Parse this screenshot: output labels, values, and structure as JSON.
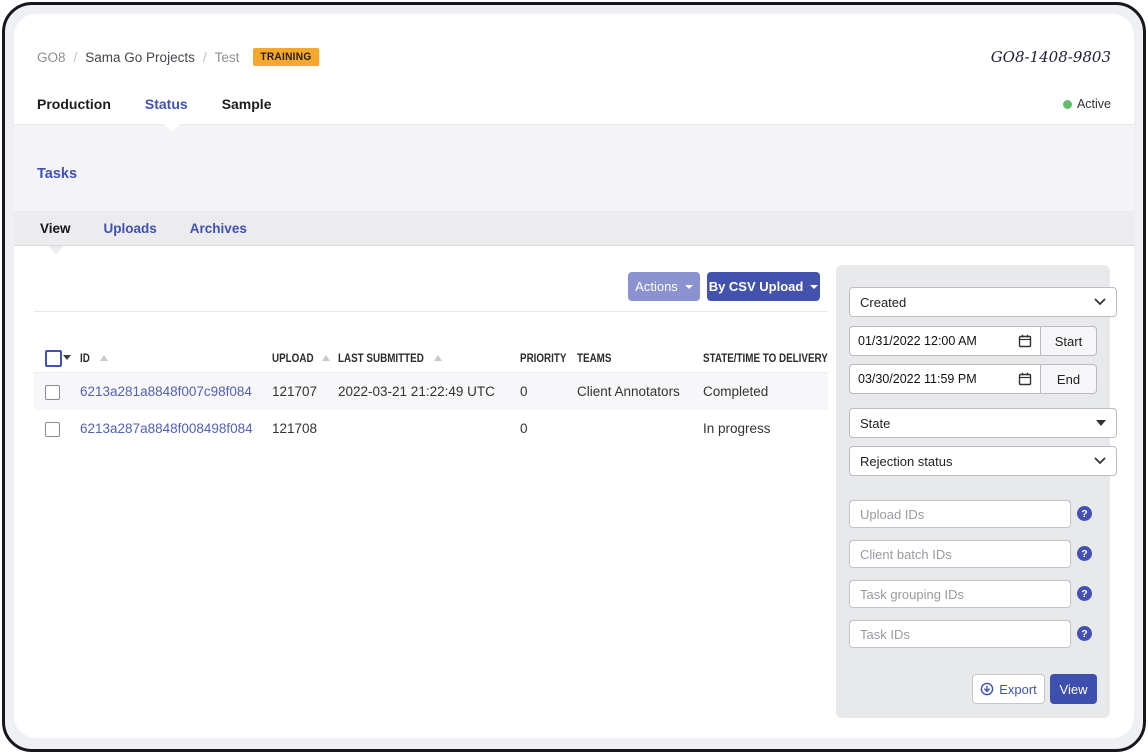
{
  "header": {
    "breadcrumb": {
      "items": [
        "GO8",
        "Sama Go Projects",
        "Test"
      ],
      "separator": "/"
    },
    "badge": "TRAINING",
    "project_code": "GO8-1408-9803"
  },
  "nav": {
    "items": [
      "Production",
      "Status",
      "Sample"
    ],
    "active": "Status",
    "status_label": "Active"
  },
  "tasks": {
    "title": "Tasks",
    "tabs": [
      "View",
      "Uploads",
      "Archives"
    ],
    "active_tab": "View"
  },
  "toolbar": {
    "actions": "Actions",
    "csv_upload": "By CSV Upload"
  },
  "table": {
    "columns": [
      "ID",
      "UPLOAD",
      "LAST SUBMITTED",
      "PRIORITY",
      "TEAMS",
      "STATE/TIME TO DELIVERY"
    ],
    "rows": [
      {
        "id": "6213a281a8848f007c98f084",
        "upload": "121707",
        "last_submitted": "2022-03-21 21:22:49 UTC",
        "priority": "0",
        "teams": "Client Annotators",
        "state": "Completed"
      },
      {
        "id": "6213a287a8848f008498f084",
        "upload": "121708",
        "last_submitted": "",
        "priority": "0",
        "teams": "",
        "state": "In progress"
      }
    ]
  },
  "filters": {
    "created": {
      "value": "Created"
    },
    "date_start": {
      "value": "01/31/2022 12:00 AM",
      "button": "Start"
    },
    "date_end": {
      "value": "03/30/2022 11:59 PM",
      "button": "End"
    },
    "state": {
      "value": "State"
    },
    "rejection_status": {
      "value": "Rejection status"
    },
    "id_inputs": [
      {
        "placeholder": "Upload IDs"
      },
      {
        "placeholder": "Client batch IDs"
      },
      {
        "placeholder": "Task grouping IDs"
      },
      {
        "placeholder": "Task IDs"
      }
    ],
    "help_glyph": "?",
    "export_label": "Export",
    "view_label": "View"
  },
  "colors": {
    "accent": "#3f51b5",
    "badge_orange": "#f5a72e",
    "active_green": "#66bb6a",
    "button_muted": "#8a93d0",
    "button_primary": "#4353ad",
    "link": "#5161b5"
  }
}
